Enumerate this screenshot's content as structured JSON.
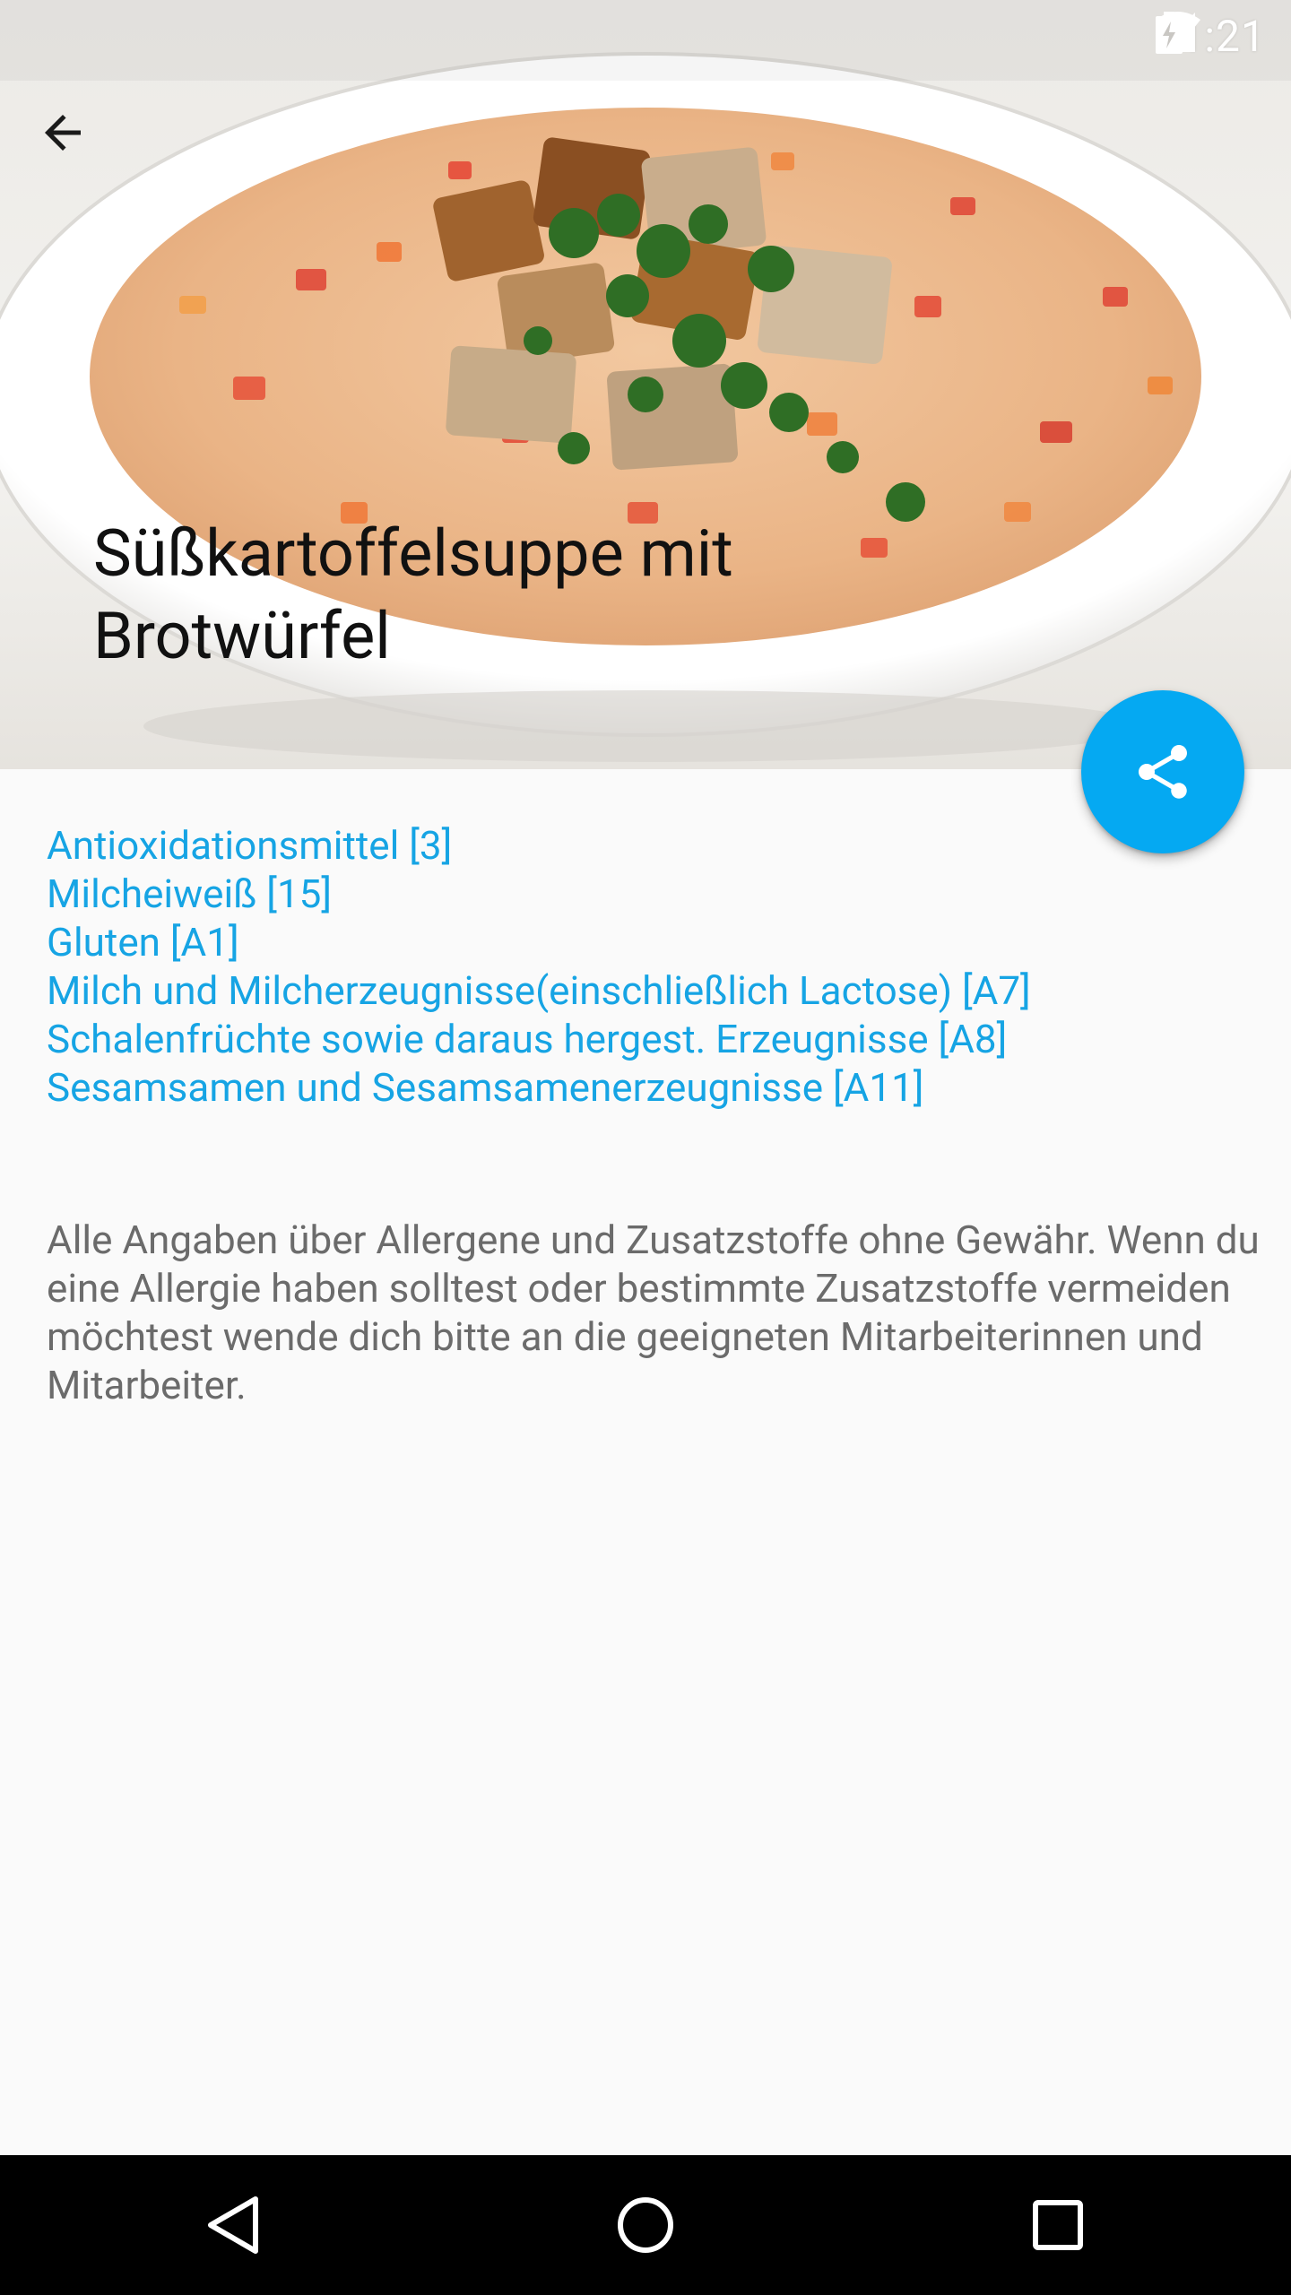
{
  "status_bar": {
    "time": "11:21",
    "icons": [
      "wifi-icon",
      "cell-signal-icon",
      "battery-charging-icon"
    ]
  },
  "header": {
    "back_icon": "arrow-back-icon",
    "title": "Süßkartoffelsuppe mit Brotwürfel",
    "image": "soup-photo"
  },
  "fab": {
    "icon": "share-icon",
    "color": "#05a9f2"
  },
  "allergens": [
    {
      "label": "Antioxidationsmittel [3]"
    },
    {
      "label": "Milcheiweiß [15]"
    },
    {
      "label": "Gluten [A1]"
    },
    {
      "label": "Milch und Milcherzeugnisse(einschließlich Lactose) [A7]"
    },
    {
      "label": "Schalenfrüchte sowie daraus hergest. Erzeugnisse [A8]"
    },
    {
      "label": "Sesamsamen und Sesamsamenerzeugnisse [A11]"
    }
  ],
  "disclaimer": "Alle Angaben über Allergene und Zusatzstoffe ohne Gewähr. Wenn du eine Allergie haben solltest oder bestimmte Zusatzstoffe vermeiden möchtest wende dich bitte an die geeigneten Mitarbeiterinnen und Mitarbeiter.",
  "colors": {
    "link": "#16a4e4",
    "accent": "#05a9f2",
    "navbar": "#000000"
  },
  "nav_bar": {
    "buttons": [
      "back-triangle-icon",
      "home-circle-icon",
      "recents-square-icon"
    ]
  }
}
